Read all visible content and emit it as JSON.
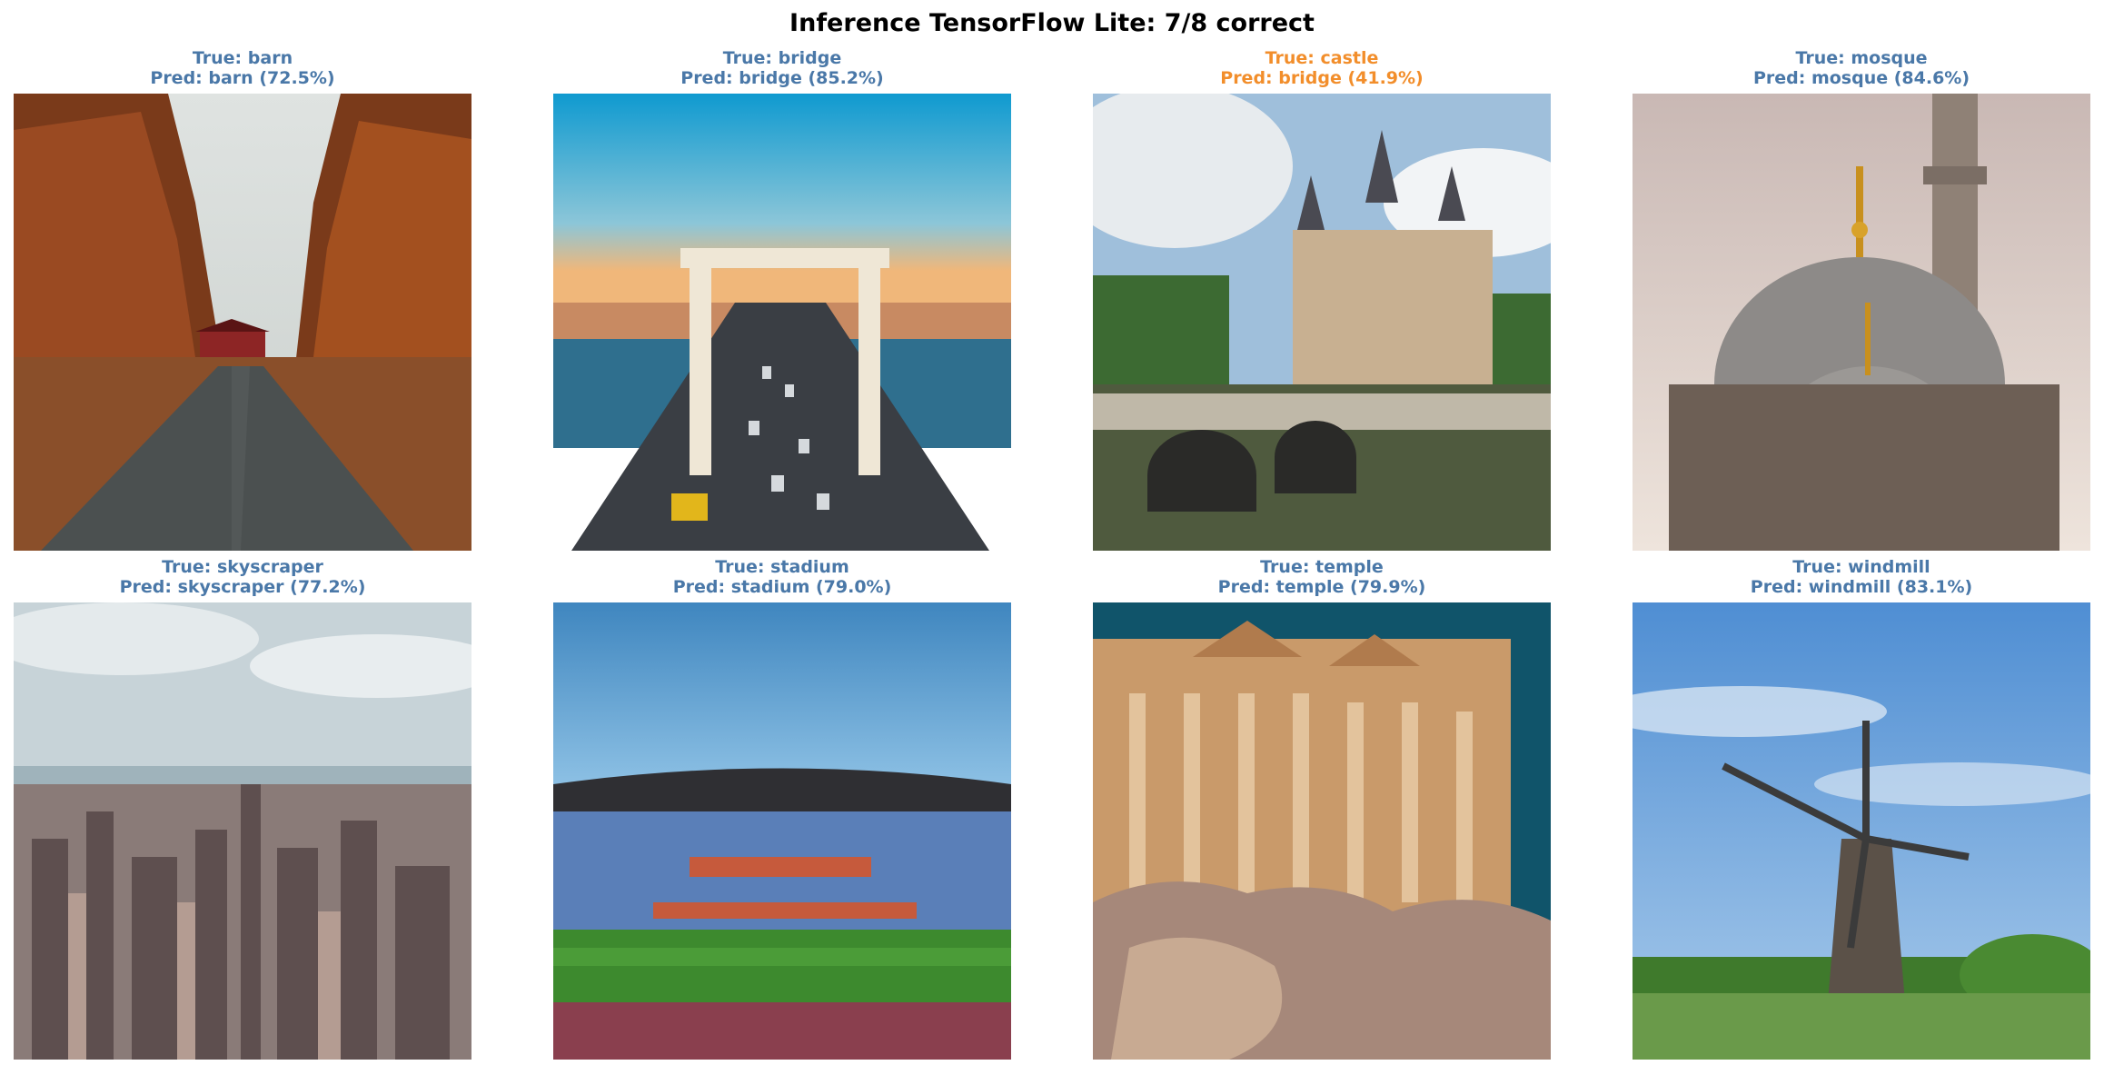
{
  "figure": {
    "title": "Inference TensorFlow Lite: 7/8 correct"
  },
  "colors": {
    "correct": "#4a78a8",
    "incorrect": "#f28e2b"
  },
  "panels": [
    {
      "true_label": "True: barn",
      "pred_label": "Pred: barn (72.5%)",
      "correct": true,
      "image": "autumn road with red barn"
    },
    {
      "true_label": "True: bridge",
      "pred_label": "Pred: bridge (85.2%)",
      "correct": true,
      "image": "white suspension bridge with traffic"
    },
    {
      "true_label": "True: castle",
      "pred_label": "Pred: bridge (41.9%)",
      "correct": false,
      "image": "castle with arched stone bridge over water"
    },
    {
      "true_label": "True: mosque",
      "pred_label": "Pred: mosque (84.6%)",
      "correct": true,
      "image": "mosque domes with golden finials and minaret"
    },
    {
      "true_label": "True: skyscraper",
      "pred_label": "Pred: skyscraper (77.2%)",
      "correct": true,
      "image": "aerial city skyline"
    },
    {
      "true_label": "True: stadium",
      "pred_label": "Pred: stadium (79.0%)",
      "correct": true,
      "image": "stadium interior with stands and pitch"
    },
    {
      "true_label": "True: temple",
      "pred_label": "Pred: temple (79.9%)",
      "correct": true,
      "image": "ancient columned temple ruins"
    },
    {
      "true_label": "True: windmill",
      "pred_label": "Pred: windmill (83.1%)",
      "correct": true,
      "image": "windmill in green field under blue sky"
    }
  ]
}
